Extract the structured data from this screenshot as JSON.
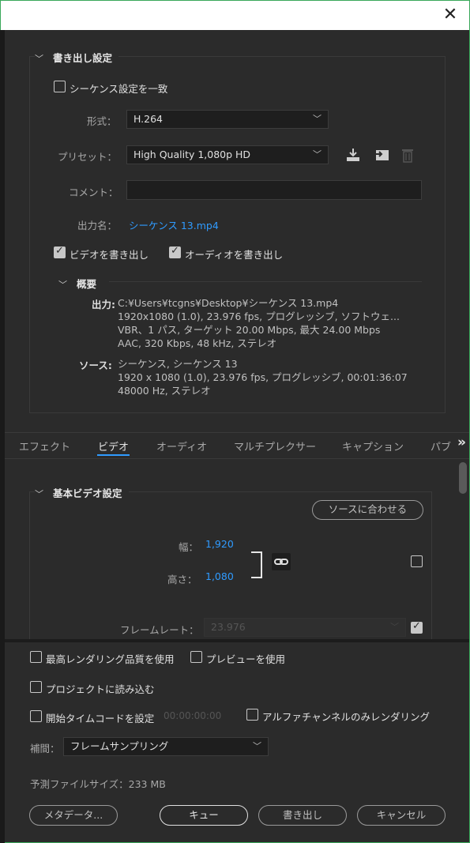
{
  "window": {
    "close_glyph": "✕"
  },
  "export_settings": {
    "section_title": "書き出し設定",
    "match_sequence_label": "シーケンス設定を一致",
    "format_label": "形式：",
    "format_value": "H.264",
    "preset_label": "プリセット：",
    "preset_value": "High Quality 1,080p HD",
    "comment_label": "コメント：",
    "comment_value": "",
    "output_name_label": "出力名：",
    "output_name_value": "シーケンス 13.mp4",
    "export_video_label": "ビデオを書き出し",
    "export_video_checked": true,
    "export_audio_label": "オーディオを書き出し",
    "export_audio_checked": true,
    "preset_icons": [
      "save-preset-icon",
      "import-preset-icon",
      "delete-preset-icon"
    ]
  },
  "summary": {
    "title": "概要",
    "output_key": "出力:",
    "output_lines": [
      "C:¥Users¥tcgns¥Desktop¥シーケンス 13.mp4",
      "1920x1080 (1.0), 23.976 fps, プログレッシブ, ソフトウェ...",
      "VBR、1 パス, ターゲット 20.00 Mbps, 最大 24.00 Mbps",
      "AAC, 320 Kbps, 48 kHz, ステレオ"
    ],
    "source_key": "ソース:",
    "source_lines": [
      "シーケンス, シーケンス 13",
      "1920 x 1080 (1.0), 23.976 fps, プログレッシブ, 00:01:36:07",
      "48000 Hz, ステレオ"
    ]
  },
  "tabs": {
    "items": [
      "エフェクト",
      "ビデオ",
      "オーディオ",
      "マルチプレクサー",
      "キャプション",
      "パブ"
    ],
    "active_index": 1,
    "more_glyph": "»"
  },
  "basic_video": {
    "section_title": "基本ビデオ設定",
    "match_source_label": "ソースに合わせる",
    "width_label": "幅：",
    "width_value": "1,920",
    "height_label": "高さ：",
    "height_value": "1,080",
    "frame_rate_label": "フレームレート：",
    "frame_rate_value": "23.976",
    "frame_rate_checked": true,
    "size_checkbox_checked": false
  },
  "bottom": {
    "max_quality_label": "最高レンダリング品質を使用",
    "use_previews_label": "プレビューを使用",
    "import_project_label": "プロジェクトに読み込む",
    "start_timecode_label": "開始タイムコードを設定",
    "start_timecode_value": "00:00:00:00",
    "alpha_only_label": "アルファチャンネルのみレンダリング",
    "interpolation_label": "補間：",
    "interpolation_value": "フレームサンプリング",
    "file_size_label": "予測ファイルサイズ：",
    "file_size_value": "233 MB",
    "metadata_button": "メタデータ...",
    "queue_button": "キュー",
    "export_button": "書き出し",
    "cancel_button": "キャンセル"
  },
  "colors": {
    "accent_blue": "#2f9bff",
    "panel_bg": "#2b2b2b",
    "field_bg": "#1e1e1e"
  }
}
